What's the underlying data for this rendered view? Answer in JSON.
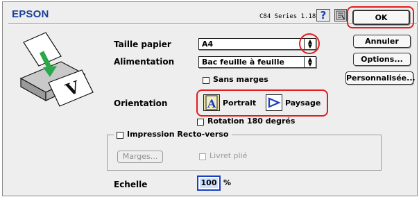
{
  "header": {
    "brand": "EPSON",
    "version": "C84 Series 1.18F"
  },
  "buttons": {
    "ok": "OK",
    "cancel": "Annuler",
    "options": "Options...",
    "custom": "Personnalisée..."
  },
  "paper": {
    "size_label": "Taille papier",
    "size_value": "A4",
    "feed_label": "Alimentation",
    "feed_value": "Bac feuille à feuille",
    "borderless_label": "Sans marges"
  },
  "orientation": {
    "label": "Orientation",
    "portrait": "Portrait",
    "landscape": "Paysage",
    "rotate_label": "Rotation 180 degrés"
  },
  "duplex": {
    "label": "Impression Recto-verso",
    "margins_button": "Marges...",
    "booklet_label": "Livret plié"
  },
  "scale": {
    "label": "Echelle",
    "value": "100",
    "unit": "%"
  },
  "colors": {
    "brand": "#1a3f9c",
    "highlight": "#e41c1c",
    "orientation_icon": "#1a3fc0"
  },
  "icons": {
    "help": "question-mark",
    "tool": "printer-utility",
    "illustration": "printer-with-paper"
  }
}
